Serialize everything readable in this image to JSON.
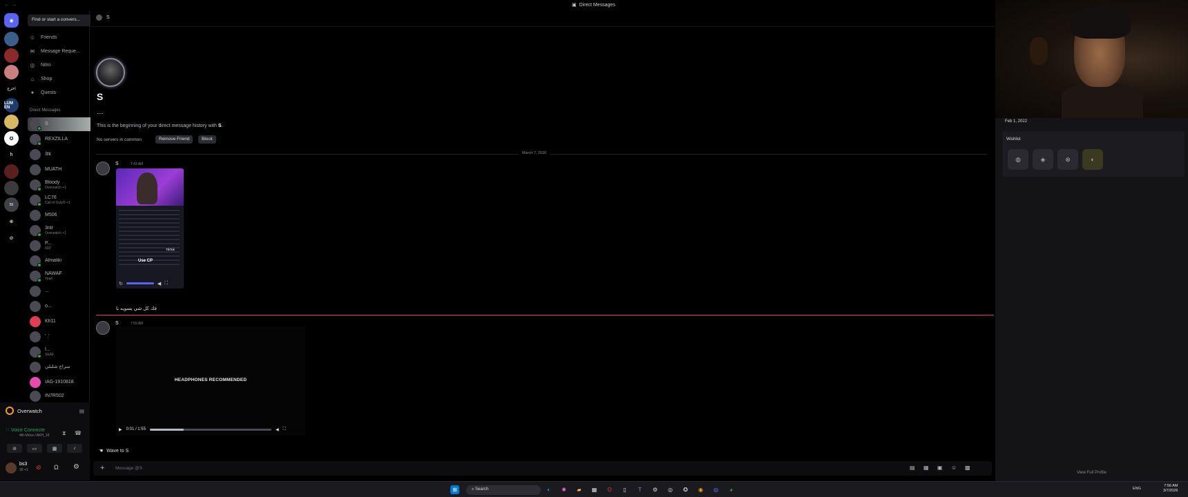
{
  "window": {
    "title": "Direct Messages"
  },
  "sidebar": {
    "search_placeholder": "Find or start a convers...",
    "nav": [
      {
        "label": "Friends",
        "icon": "friends-icon"
      },
      {
        "label": "Message Reque...",
        "icon": "mail-icon"
      },
      {
        "label": "Nitro",
        "icon": "nitro-icon"
      },
      {
        "label": "Shop",
        "icon": "shop-icon"
      },
      {
        "label": "Quests",
        "icon": "quests-icon"
      }
    ],
    "dm_header": "Direct Messages",
    "dms": [
      {
        "name": "S",
        "sub": ""
      },
      {
        "name": "REXZILLA",
        "sub": ""
      },
      {
        "name": "3lk",
        "sub": ""
      },
      {
        "name": "MUATH",
        "sub": ""
      },
      {
        "name": "Bloody",
        "sub": "Overwatch +1"
      },
      {
        "name": "LC76",
        "sub": "Call of Duty® +1"
      },
      {
        "name": "M506",
        "sub": ""
      },
      {
        "name": "3ntr",
        "sub": "Overwatch +1"
      },
      {
        "name": "P...",
        "sub": "602"
      },
      {
        "name": "Almaliki",
        "sub": ""
      },
      {
        "name": "NAWAF",
        "sub": "Yeah"
      },
      {
        "name": "...",
        "sub": ""
      },
      {
        "name": "o...",
        "sub": ""
      },
      {
        "name": "Kh11",
        "sub": ""
      },
      {
        "name": "' .'",
        "sub": ""
      },
      {
        "name": "I...",
        "sub": "SEAF"
      },
      {
        "name": "سراج شلبلي",
        "sub": ""
      },
      {
        "name": "IAG-1910818",
        "sub": ""
      },
      {
        "name": "IN7R502",
        "sub": ""
      }
    ]
  },
  "userpanel": {
    "activity": "Overwatch",
    "voice_status": "Voice Connecte",
    "voice_sub": "4th-Voice / AKH_10",
    "username": "bs3",
    "user_sub": "30 +1"
  },
  "rail": {
    "label_h": "h",
    "label_kh": "اخرج",
    "label_lumen": "LUM EN",
    "badge": "55"
  },
  "chat": {
    "channel_name": "S",
    "profile_name": "S",
    "dots": "....",
    "intro_prefix": "This is the beginning of your direct message history with ",
    "intro_name": "S",
    "intro_suffix": ".",
    "no_servers": "No servers in common",
    "remove_friend": "Remove Friend",
    "block": "Block",
    "date_divider": "March 7, 2026",
    "msg1": {
      "author": "S",
      "time": "7:43 AM",
      "text": "فك كل شي يسويه نا"
    },
    "msg1_media": {
      "badge": "Use CP",
      "brand": "TikTok"
    },
    "new_tag": "NEW",
    "msg2": {
      "author": "S",
      "time": "7:55 AM"
    },
    "video_caption": "HEADPHONES RECOMMENDED",
    "video_time": "0:01 / 1:55",
    "video_progress": 0.28,
    "wave_label": "Wave to S",
    "composer_placeholder": "Message @S"
  },
  "profile": {
    "member_since": "Feb 1, 2022",
    "wishlist_label": "Wishlist",
    "view_full": "View Full Profile"
  },
  "taskbar": {
    "search": "Search",
    "time": "7:56 AM",
    "date": "3/7/2026",
    "lang": "ENG"
  },
  "colors": {
    "accent": "#5865f2",
    "online": "#23a55a",
    "new_line": "#f23f42"
  }
}
